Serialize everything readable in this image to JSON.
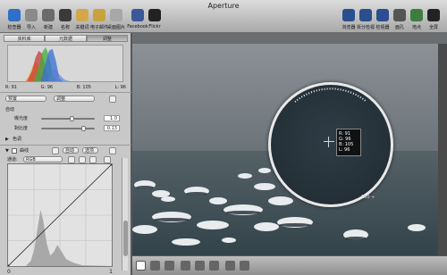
{
  "window": {
    "title": "Aperture"
  },
  "toolbar": {
    "left": [
      {
        "label": "检查器",
        "icon": "inspector-icon",
        "color": "#2f6fc8"
      },
      {
        "label": "导入",
        "icon": "import-icon",
        "color": "#8a8a8a"
      },
      {
        "label": "新建",
        "icon": "new-icon",
        "color": "#6a6a6a"
      },
      {
        "label": "名称",
        "icon": "faces-icon",
        "color": "#3a3a3a"
      },
      {
        "label": "关键词",
        "icon": "keyword-icon",
        "color": "#d4a84a"
      },
      {
        "label": "电子邮件",
        "icon": "email-icon",
        "color": "#c9a23e"
      },
      {
        "label": "桌面图片",
        "icon": "desktop-picture-icon",
        "color": "#a7a7a7"
      },
      {
        "label": "Facebook",
        "icon": "facebook-icon",
        "color": "#3b5998"
      },
      {
        "label": "Flickr",
        "icon": "flickr-icon",
        "color": "#222222"
      }
    ],
    "right": [
      {
        "label": "浏览器",
        "icon": "browser-icon",
        "color": "#2b4e8f"
      },
      {
        "label": "拆分检视",
        "icon": "split-view-icon",
        "color": "#2b4e8f"
      },
      {
        "label": "检视器",
        "icon": "viewer-icon",
        "color": "#2b4e8f"
      },
      {
        "label": "面孔",
        "icon": "faces-view-icon",
        "color": "#555555"
      },
      {
        "label": "地点",
        "icon": "places-icon",
        "color": "#3f7d3f"
      },
      {
        "label": "全屏",
        "icon": "fullscreen-icon",
        "color": "#222222"
      }
    ]
  },
  "inspector": {
    "tabs": [
      "资料库",
      "元数据",
      "调整"
    ],
    "active_tab": "调整",
    "histogram": {
      "r": "R: 91",
      "g": "G: 96",
      "b": "B: 105",
      "l": "L: 96"
    },
    "preset_label": "预置",
    "adjust_label": "调整",
    "auto_label": "自动",
    "exposure_label": "曝光度",
    "exposure_value": "1.0",
    "contrast_label": "對比度",
    "contrast_value": "0.13",
    "exposure_fill": 0.5,
    "contrast_fill": 0.72,
    "tint_label": "色调",
    "curves_label": "曲线",
    "auto_levels_label": "自动",
    "options_label": "选项",
    "channel_label": "通道:",
    "channel_value": "RGB",
    "curve_min": "0",
    "curve_max": "1"
  },
  "viewer": {
    "loupe": {
      "r": "R:  91",
      "g": "G:  96",
      "b": "B: 105",
      "l": "L:  96",
      "zoom": "100 ÷"
    }
  }
}
